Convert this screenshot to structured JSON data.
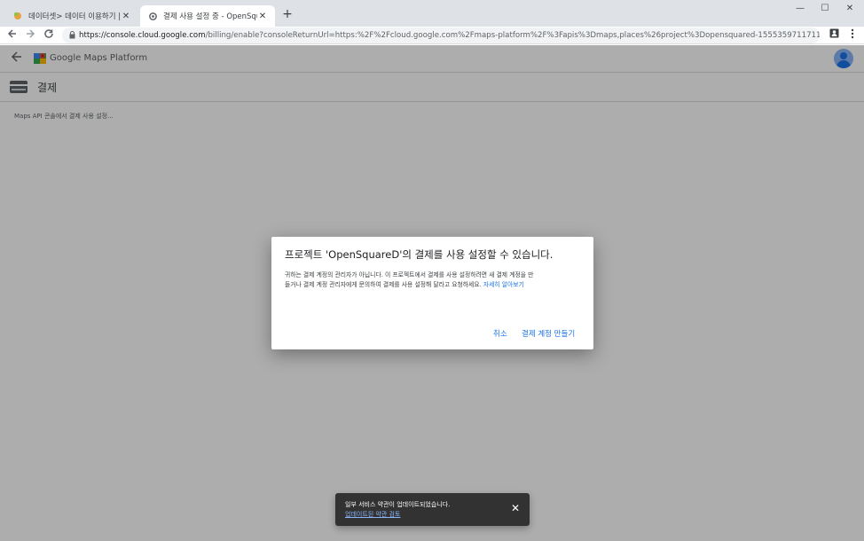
{
  "browser": {
    "tabs": [
      {
        "title": "데이터셋> 데이터 이용하기 | 서",
        "favicon": "dataset-icon",
        "active": false
      },
      {
        "title": "결제 사용 설정 중 - OpenSquare",
        "favicon": "gear-icon",
        "active": true
      }
    ],
    "close_glyph": "✕",
    "new_tab_glyph": "+",
    "window_controls": {
      "minimize": "—",
      "maximize": "☐",
      "close": "✕"
    },
    "url_host": "https://console.cloud.google.com",
    "url_path": "/billing/enable?consoleReturnUrl=https:%2F%2Fcloud.google.com%2Fmaps-platform%2F%3Fapis%3Dmaps,places%26project%3Dopensquared-1555359711711&redirect..."
  },
  "app": {
    "brand": "Google Maps Platform",
    "section_title": "결제",
    "status": "Maps API 콘솔에서 결제 사용 설정..."
  },
  "dialog": {
    "title": "프로젝트 'OpenSquareD'의 결제를 사용 설정할 수 있습니다.",
    "body": "귀하는 결제 계정의 관리자가 아닙니다. 이 프로젝트에서 결제를 사용 설정하려면 새 결제 계정을 만들거나 결제 계정 관리자에게 문의하여 결제를 사용 설정해 달라고 요청하세요. ",
    "learn_more": "자세히 알아보기",
    "cancel_label": "취소",
    "create_label": "결제 계정 만들기"
  },
  "snackbar": {
    "message": "일부 서비스 약관이 업데이트되었습니다.",
    "link": "업데이트된 약관 검토",
    "close_glyph": "✕"
  },
  "colors": {
    "accent": "#1a73e8",
    "scrim": "rgba(0,0,0,0.32)",
    "snackbar_bg": "#323232"
  }
}
